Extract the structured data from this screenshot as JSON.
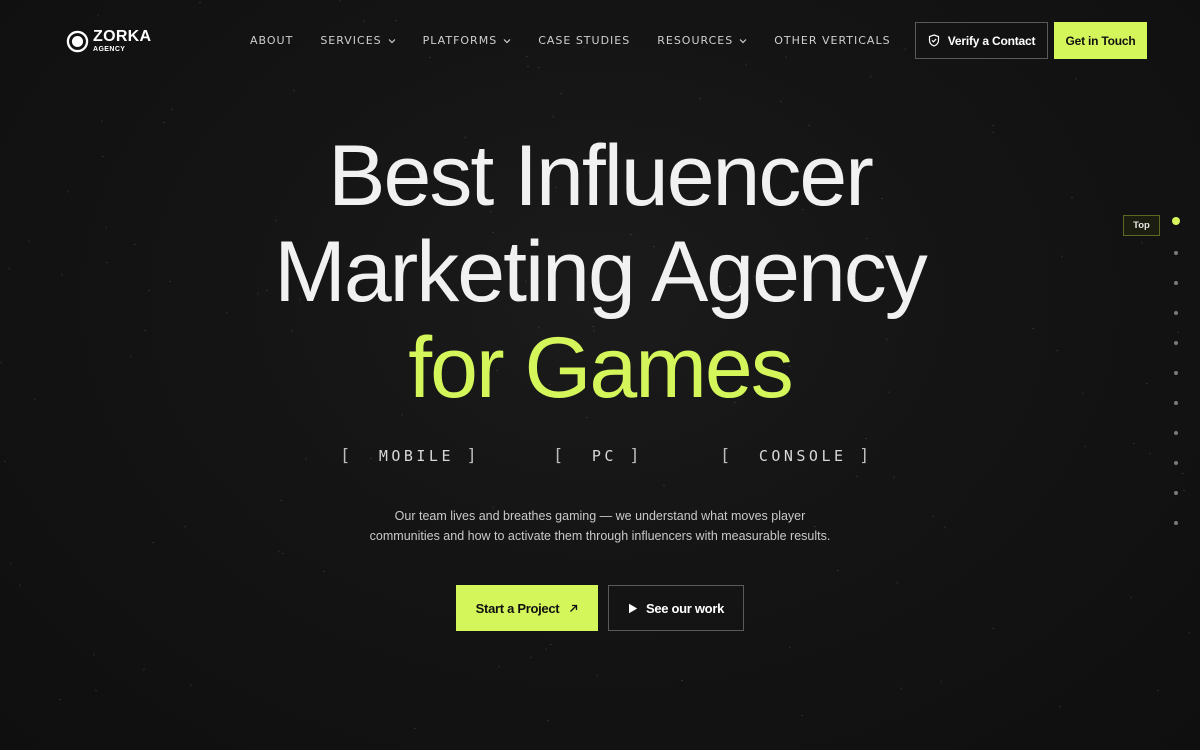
{
  "brand": {
    "name": "ZORKA",
    "sub": "AGENCY"
  },
  "nav": [
    {
      "label": "ABOUT",
      "dropdown": false
    },
    {
      "label": "SERVICES",
      "dropdown": true
    },
    {
      "label": "PLATFORMS",
      "dropdown": true
    },
    {
      "label": "CASE STUDIES",
      "dropdown": false
    },
    {
      "label": "RESOURCES",
      "dropdown": true
    },
    {
      "label": "OTHER VERTICALS",
      "dropdown": false
    }
  ],
  "header": {
    "verify_label": "Verify a Contact",
    "verify_icon": "shield-check-icon",
    "cta_label": "Get in Touch"
  },
  "hero": {
    "line1": "Best Influencer",
    "line2": "Marketing Agency",
    "line3": "for Games",
    "platforms": [
      "MOBILE",
      "PC",
      "CONSOLE"
    ],
    "description_line1": "Our team lives and breathes gaming — we understand what moves player",
    "description_line2": "communities and how to activate them through influencers with measurable results.",
    "start_label": "Start a Project",
    "start_icon": "arrow-up-right-icon",
    "work_label": "See our work",
    "work_icon": "play-icon"
  },
  "side_nav": {
    "top_label": "Top",
    "dot_count": 11,
    "active_index": 0
  },
  "colors": {
    "accent": "#d4f65a",
    "background": "#121212",
    "text": "#f1f1f1"
  }
}
